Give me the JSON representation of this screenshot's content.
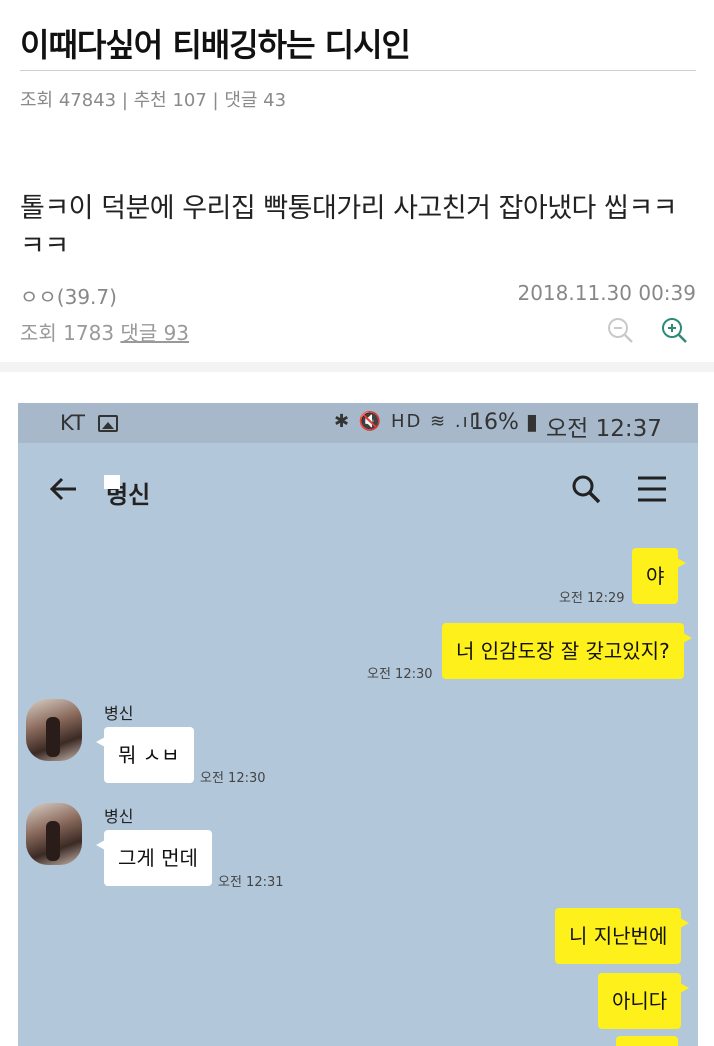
{
  "post": {
    "title": "이때다싶어 티배깅하는 디시인",
    "meta": "조회 47843 | 추천 107 | 댓글 43"
  },
  "inner_post": {
    "title": "톨ㅋ이 덕분에 우리집 빡통대가리 사고친거 잡아냈다 씹ㅋㅋㅋㅋ",
    "author": "ㅇㅇ(39.7)",
    "date": "2018.11.30 00:39",
    "views_label": "조회 1783",
    "comments_label": "댓글 93"
  },
  "phone": {
    "status": {
      "carrier": "KT",
      "icons": "✱ 🔇 HD ≋ .ıl",
      "battery": "16% ▮",
      "time": "오전 12:37"
    },
    "chat_name": "병신",
    "messages": [
      {
        "from": "me",
        "text": "야",
        "time": "오전 12:29"
      },
      {
        "from": "me",
        "text": "너 인감도장 잘 갖고있지?",
        "time": "오전 12:30"
      },
      {
        "from": "other",
        "sender": "병신",
        "text": "뭐 ㅅㅂ",
        "time": "오전 12:30"
      },
      {
        "from": "other",
        "sender": "병신",
        "text": "그게 먼데",
        "time": "오전 12:31"
      },
      {
        "from": "me",
        "text": "니 지난번에",
        "time": ""
      },
      {
        "from": "me",
        "text": "아니다",
        "time": ""
      }
    ]
  },
  "colors": {
    "chat_bg": "#b2c7da",
    "my_bubble": "#fef01b",
    "other_bubble": "#ffffff"
  }
}
